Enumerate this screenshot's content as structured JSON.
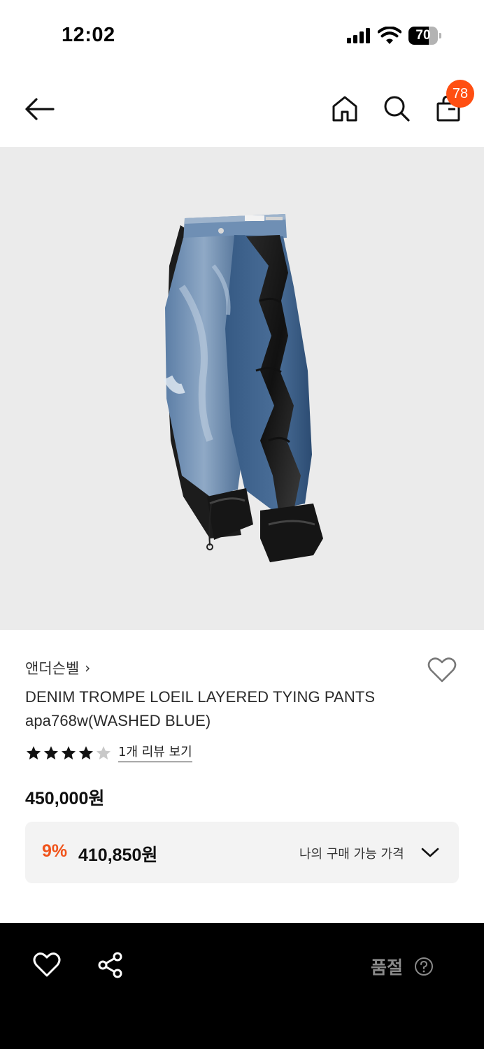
{
  "status_bar": {
    "time": "12:02",
    "battery_level": "70",
    "battery_fraction": 0.7
  },
  "header": {
    "icons": [
      "back-arrow-icon",
      "home-icon",
      "search-icon",
      "shopping-bag-icon"
    ],
    "cart_count": "78"
  },
  "product": {
    "brand": "앤더슨벨",
    "brand_chevron": "›",
    "title_line1": "DENIM TROMPE LOEIL LAYERED TYING PANTS",
    "title_line2": "apa768w(WASHED BLUE)",
    "rating": 4,
    "rating_max": 5,
    "review_link": "1개 리뷰 보기",
    "price": "450,000원",
    "discount_rate": "9%",
    "discount_price": "410,850원",
    "my_price_label": "나의 구매 가능 가격"
  },
  "bottom_bar": {
    "soldout_label": "품절",
    "icons": [
      "heart-icon",
      "share-icon",
      "help-icon"
    ]
  },
  "colors": {
    "accent": "#ff4f12",
    "discount": "#f0541c",
    "image_bg": "#ebebeb",
    "bottom_bar": "#000000",
    "star_filled": "#111111",
    "star_empty": "#c8c8c8"
  }
}
